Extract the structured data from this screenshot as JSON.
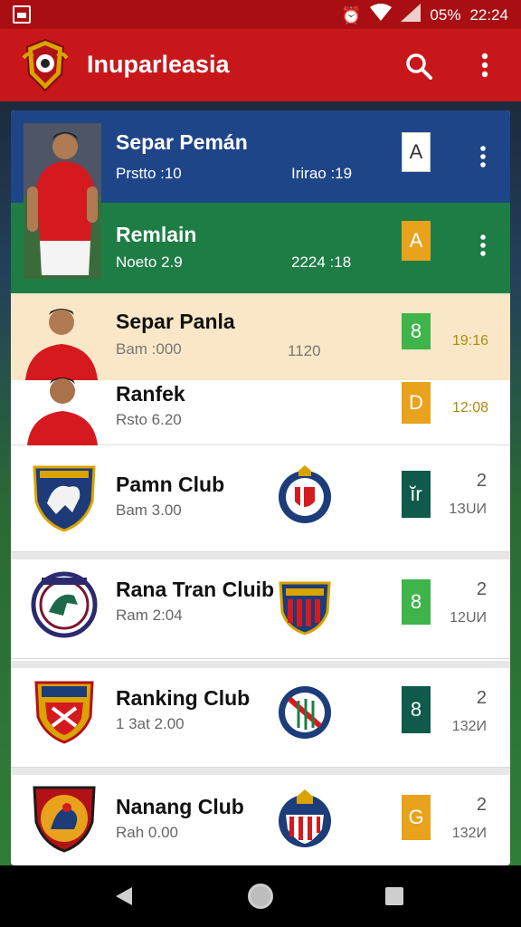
{
  "status_bar": {
    "battery_text": "05%",
    "time": "22:24"
  },
  "app_bar": {
    "title": "Inuparleasia"
  },
  "players": [
    {
      "name": "Separ Pemán",
      "stat_left": "Prstto :10",
      "stat_mid": "Irirao :19",
      "grade": "A"
    },
    {
      "name": "Remlain",
      "stat_left": "Noeto 2.9",
      "stat_mid": "2224 :18",
      "grade": "A"
    },
    {
      "name": "Separ Panla",
      "stat_left": "Bam :000",
      "stat_mid": "1120",
      "grade": "8",
      "stat_right": "19:16"
    },
    {
      "name": "Ranfek",
      "stat_left": "Rsto 6.20",
      "grade": "D",
      "stat_right": "12:08"
    }
  ],
  "clubs": [
    {
      "name": "Pamn Club",
      "stat": "Bam 3.00",
      "grade": "ĭr",
      "rank": "2",
      "rank_sub": "1ЗUИ"
    },
    {
      "name": "Rana Tran Cluib",
      "stat": "Ram 2:04",
      "grade": "8",
      "rank": "2",
      "rank_sub": "12UИ"
    },
    {
      "name": "Ranking Club",
      "stat": "1 3at 2.00",
      "grade": "8",
      "rank": "2",
      "rank_sub": "132И"
    },
    {
      "name": "Nanang Club",
      "stat": "Rah 0.00",
      "grade": "G",
      "rank": "2",
      "rank_sub": "132И"
    }
  ],
  "colors": {
    "appbar": "#c8171b",
    "status_bar": "#a90f12",
    "row_blue": "#1f4589",
    "row_green": "#1e7d45",
    "row_cream": "#f9e7c7",
    "grade_orange": "#e8a21c",
    "grade_green": "#3fb44a",
    "grade_teal": "#0f5a4a"
  }
}
